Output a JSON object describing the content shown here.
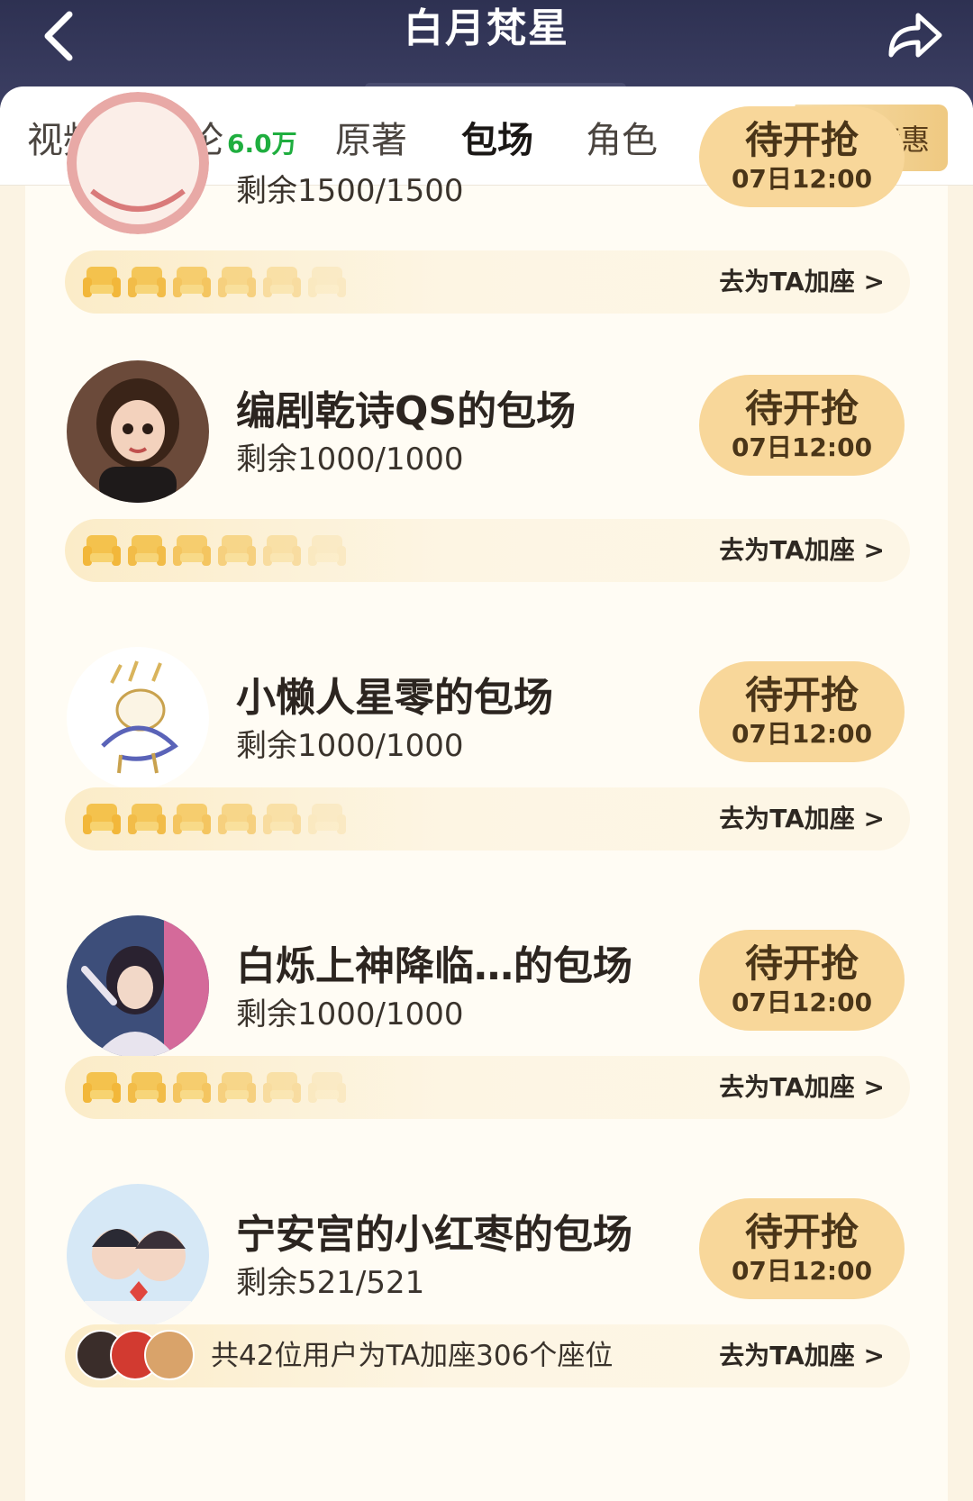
{
  "header": {
    "title": "白月梵星",
    "back_icon": "chevron-left-icon",
    "share_icon": "share-arrow-icon"
  },
  "tabs": [
    {
      "label": "视频",
      "active": false
    },
    {
      "label": "讨论",
      "badge": "6.0万",
      "active": false
    },
    {
      "label": "原著",
      "active": false
    },
    {
      "label": "包场",
      "active": true
    },
    {
      "label": "角色",
      "active": false
    }
  ],
  "promo": {
    "label": "年卡特惠"
  },
  "colors": {
    "header_bg": "#2e3152",
    "button_bg": "#f8d79a",
    "seat_gold": "#f4c24d",
    "badge_green": "#1fae3f"
  },
  "common": {
    "seat_link": "去为TA加座 >",
    "grab_label": "待开抢",
    "grab_time": "07日12:00"
  },
  "items": [
    {
      "title": "",
      "remain": "剩余1500/1500",
      "seat_summary": ""
    },
    {
      "title": "编剧乾诗QS的包场",
      "remain": "剩余1000/1000",
      "seat_summary": ""
    },
    {
      "title": "小懒人星零的包场",
      "remain": "剩余1000/1000",
      "seat_summary": ""
    },
    {
      "title": "白烁上神降临…的包场",
      "remain": "剩余1000/1000",
      "seat_summary": ""
    },
    {
      "title": "宁安宫的小红枣的包场",
      "remain": "剩余521/521",
      "seat_summary": "共42位用户为TA加座306个座位"
    }
  ]
}
